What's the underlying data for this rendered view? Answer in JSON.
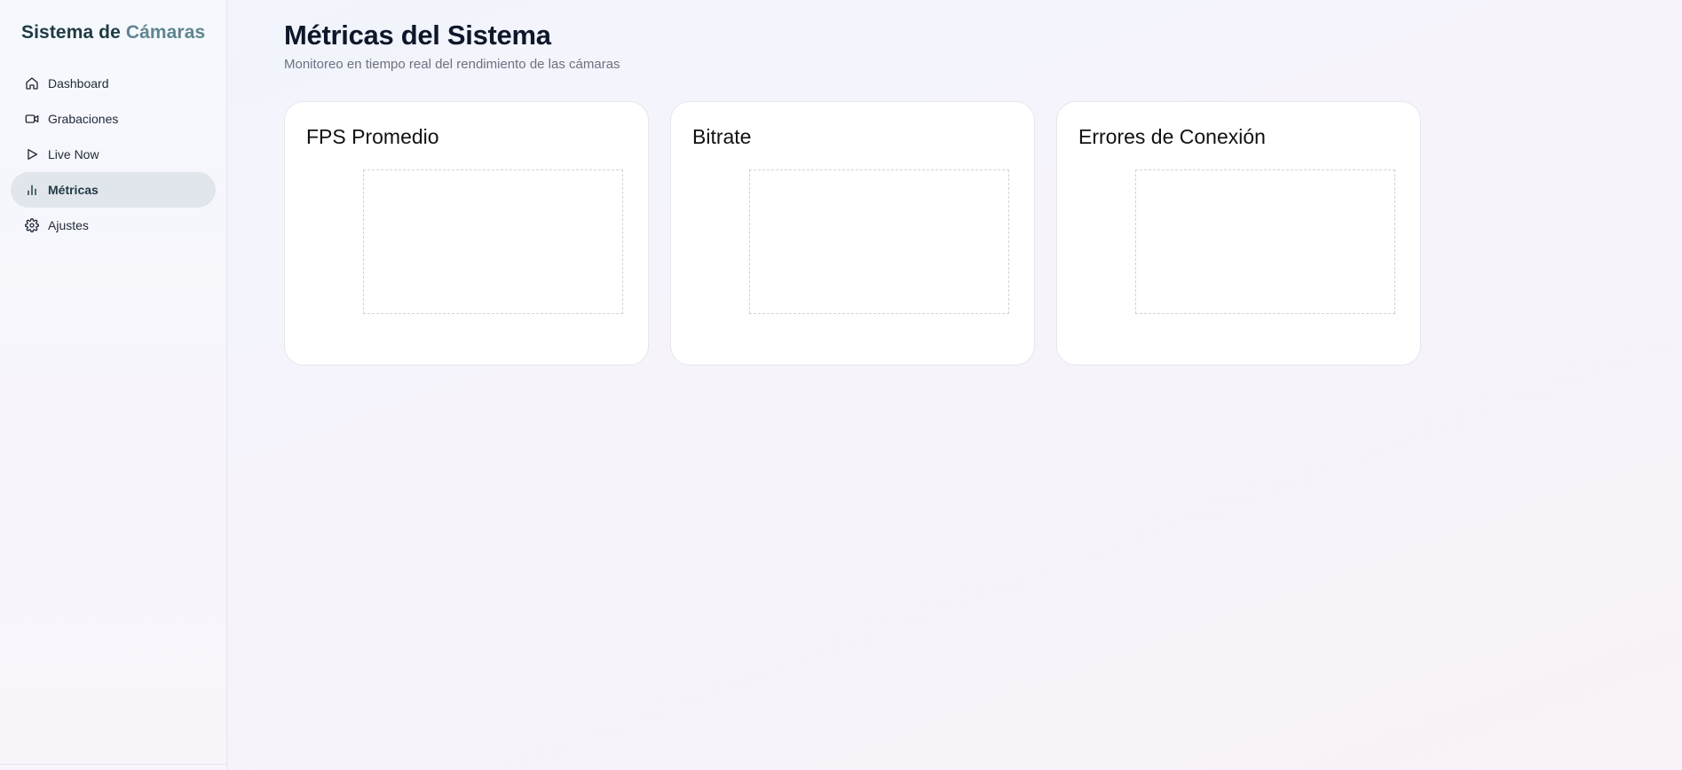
{
  "sidebar": {
    "brand_part1": "Sistema de",
    "brand_part2": "Cámaras",
    "items": [
      {
        "label": "Dashboard",
        "icon": "home-icon",
        "active": false
      },
      {
        "label": "Grabaciones",
        "icon": "video-camera-icon",
        "active": false
      },
      {
        "label": "Live Now",
        "icon": "play-icon",
        "active": false
      },
      {
        "label": "Métricas",
        "icon": "bar-chart-icon",
        "active": true
      },
      {
        "label": "Ajustes",
        "icon": "gear-icon",
        "active": false
      }
    ]
  },
  "main": {
    "title": "Métricas del Sistema",
    "subtitle": "Monitoreo en tiempo real del rendimiento de las cámaras",
    "cards": [
      {
        "title": "FPS Promedio"
      },
      {
        "title": "Bitrate"
      },
      {
        "title": "Errores de Conexión"
      }
    ]
  },
  "colors": {
    "brand_dark": "#1f3a44",
    "brand_light": "#5f8590",
    "active_nav_bg": "#e1e6ec"
  }
}
